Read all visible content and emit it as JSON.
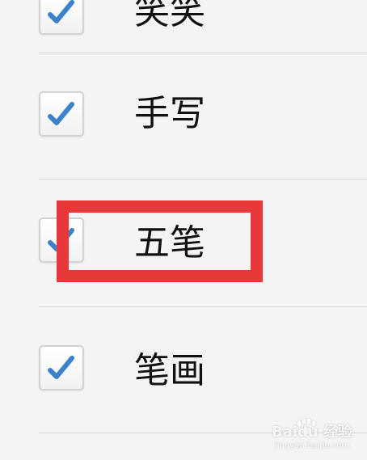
{
  "options": [
    {
      "label": "笑笑",
      "checked": true
    },
    {
      "label": "手写",
      "checked": true
    },
    {
      "label": "五笔",
      "checked": true
    },
    {
      "label": "笔画",
      "checked": true
    }
  ],
  "colors": {
    "checkmark": "#3d82c8",
    "highlight": "#e8383a",
    "background": "#f4f4f4"
  },
  "watermark": {
    "brand": "Baidu 经验",
    "url": "jingyan.baidu.com"
  }
}
